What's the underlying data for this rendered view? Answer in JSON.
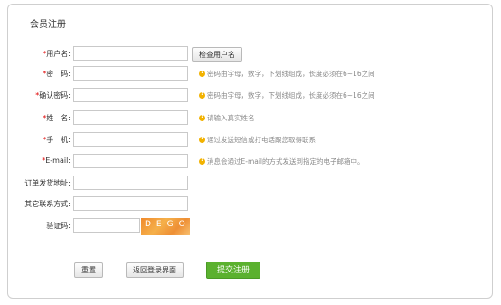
{
  "title": "会员注册",
  "check_button": "检查用户名",
  "fields": [
    {
      "label": "用户名:",
      "hint": ""
    },
    {
      "label": "密　码:",
      "hint": "密码由字母，数字，下划线组成，长度必须在6~16之间"
    },
    {
      "label": "确认密码:",
      "hint": "密码由字母，数字，下划线组成，长度必须在6~16之间"
    },
    {
      "label": "姓　名:",
      "hint": "请输入真实姓名"
    },
    {
      "label": "手　机:",
      "hint": "通过发送短信或打电话跟您取得联系"
    },
    {
      "label": "E-mail:",
      "hint": "消息会通过E-mail的方式发送到指定的电子邮箱中。"
    },
    {
      "label": "订单发货地址:",
      "hint": ""
    },
    {
      "label": "其它联系方式:",
      "hint": ""
    },
    {
      "label": "验证码:",
      "hint": ""
    }
  ],
  "required_mark": "*",
  "captcha_text": "DEGO",
  "buttons": {
    "reset": "重置",
    "back": "返回登录界面",
    "submit": "提交注册"
  }
}
